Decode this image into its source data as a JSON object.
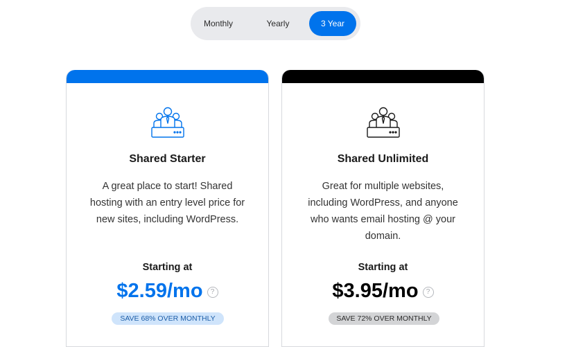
{
  "billing_toggle": {
    "options": [
      "Monthly",
      "Yearly",
      "3 Year"
    ],
    "selected": "3 Year"
  },
  "colors": {
    "accent_blue": "#0073ec",
    "black": "#000000",
    "savings_blue_bg": "#cfe4fb",
    "savings_gray_bg": "#d3d4d6"
  },
  "plans": [
    {
      "icon": "users-server-icon",
      "name": "Shared Starter",
      "description": "A great place to start! Shared hosting with an entry level price for new sites, including WordPress.",
      "starting_label": "Starting at",
      "price": "$2.59/mo",
      "help": "?",
      "savings": "SAVE 68% OVER MONTHLY",
      "accent": "#0073ec",
      "price_color": "#0073ec"
    },
    {
      "icon": "users-server-icon",
      "name": "Shared Unlimited",
      "description": "Great for multiple websites, including WordPress, and anyone who wants email hosting @ your domain.",
      "starting_label": "Starting at",
      "price": "$3.95/mo",
      "help": "?",
      "savings": "SAVE 72% OVER MONTHLY",
      "accent": "#000000",
      "price_color": "#000000"
    }
  ]
}
